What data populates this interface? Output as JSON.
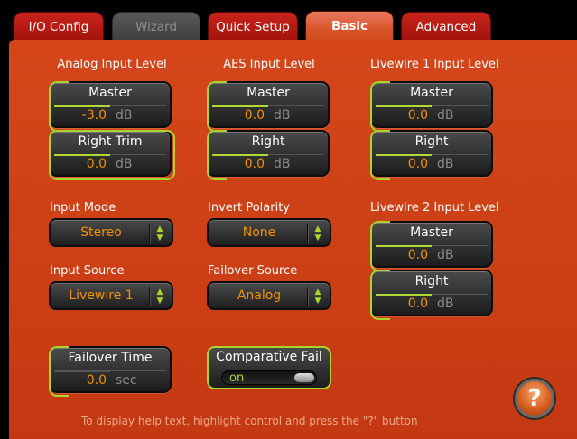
{
  "tabs": [
    {
      "label": "I/O Config",
      "state": "normal"
    },
    {
      "label": "Wizard",
      "state": "disabled"
    },
    {
      "label": "Quick Setup",
      "state": "normal"
    },
    {
      "label": "Basic",
      "state": "active"
    },
    {
      "label": "Advanced",
      "state": "normal"
    }
  ],
  "analog": {
    "heading": "Analog Input Level",
    "master": {
      "title": "Master",
      "value": "-3.0",
      "unit": "dB"
    },
    "right_trim": {
      "title": "Right Trim",
      "value": "0.0",
      "unit": "dB"
    }
  },
  "aes": {
    "heading": "AES Input Level",
    "master": {
      "title": "Master",
      "value": "0.0",
      "unit": "dB"
    },
    "right": {
      "title": "Right",
      "value": "0.0",
      "unit": "dB"
    }
  },
  "livewire1": {
    "heading": "Livewire 1 Input Level",
    "master": {
      "title": "Master",
      "value": "0.0",
      "unit": "dB"
    },
    "right": {
      "title": "Right",
      "value": "0.0",
      "unit": "dB"
    }
  },
  "livewire2": {
    "heading": "Livewire 2 Input Level",
    "master": {
      "title": "Master",
      "value": "0.0",
      "unit": "dB"
    },
    "right": {
      "title": "Right",
      "value": "0.0",
      "unit": "dB"
    }
  },
  "input_mode": {
    "label": "Input Mode",
    "value": "Stereo"
  },
  "invert_polarity": {
    "label": "Invert Polarity",
    "value": "None"
  },
  "input_source": {
    "label": "Input Source",
    "value": "Livewire 1"
  },
  "failover_source": {
    "label": "Failover Source",
    "value": "Analog"
  },
  "failover_time": {
    "title": "Failover Time",
    "value": "0.0",
    "unit": "sec"
  },
  "comparative_fail": {
    "title": "Comparative Fail",
    "value": "on"
  },
  "help": {
    "text": "To display help text, highlight control and press the \"?\" button",
    "button": "?"
  },
  "colors": {
    "accent": "#a8d62a",
    "value": "#f29100",
    "panel": "#cc3f16"
  }
}
